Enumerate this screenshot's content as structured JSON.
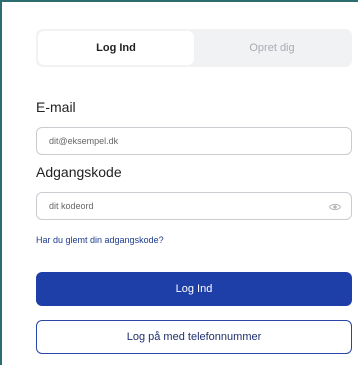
{
  "tabs": {
    "login_label": "Log Ind",
    "signup_label": "Opret dig"
  },
  "form": {
    "email_label": "E-mail",
    "email_placeholder": "dit@eksempel.dk",
    "password_label": "Adgangskode",
    "password_placeholder": "dit kodeord",
    "forgot_link": "Har du glemt din adgangskode?"
  },
  "buttons": {
    "login_label": "Log Ind",
    "phone_login_label": "Log på med telefonnummer"
  },
  "colors": {
    "primary": "#1f3fa8",
    "link": "#1b3a8f",
    "frame_border": "#2c6e6f"
  },
  "icons": {
    "password_toggle": "eye-icon"
  }
}
